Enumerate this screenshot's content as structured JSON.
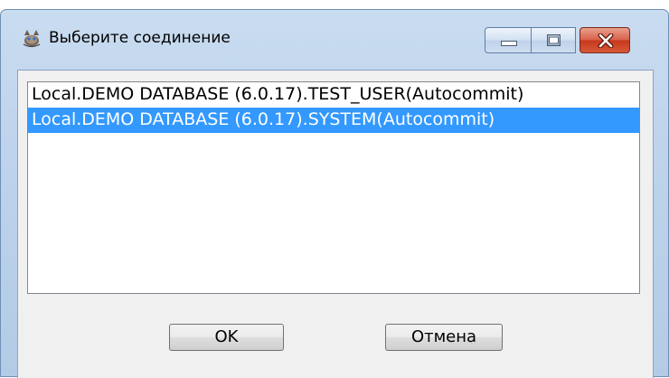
{
  "window": {
    "title": "Выберите соединение",
    "icon": "connection-app-icon",
    "controls": [
      "minimize-icon",
      "maximize-icon",
      "close-icon"
    ]
  },
  "connections": [
    {
      "label": "Local.DEMO DATABASE (6.0.17).TEST_USER(Autocommit)",
      "selected": false
    },
    {
      "label": "Local.DEMO DATABASE (6.0.17).SYSTEM(Autocommit)",
      "selected": true
    }
  ],
  "buttons": {
    "ok_label": "OK",
    "cancel_label": "Отмена"
  },
  "colors": {
    "selection": "#3399ff",
    "close_button": "#c8381d",
    "title_bar": "#bfd4ec"
  }
}
